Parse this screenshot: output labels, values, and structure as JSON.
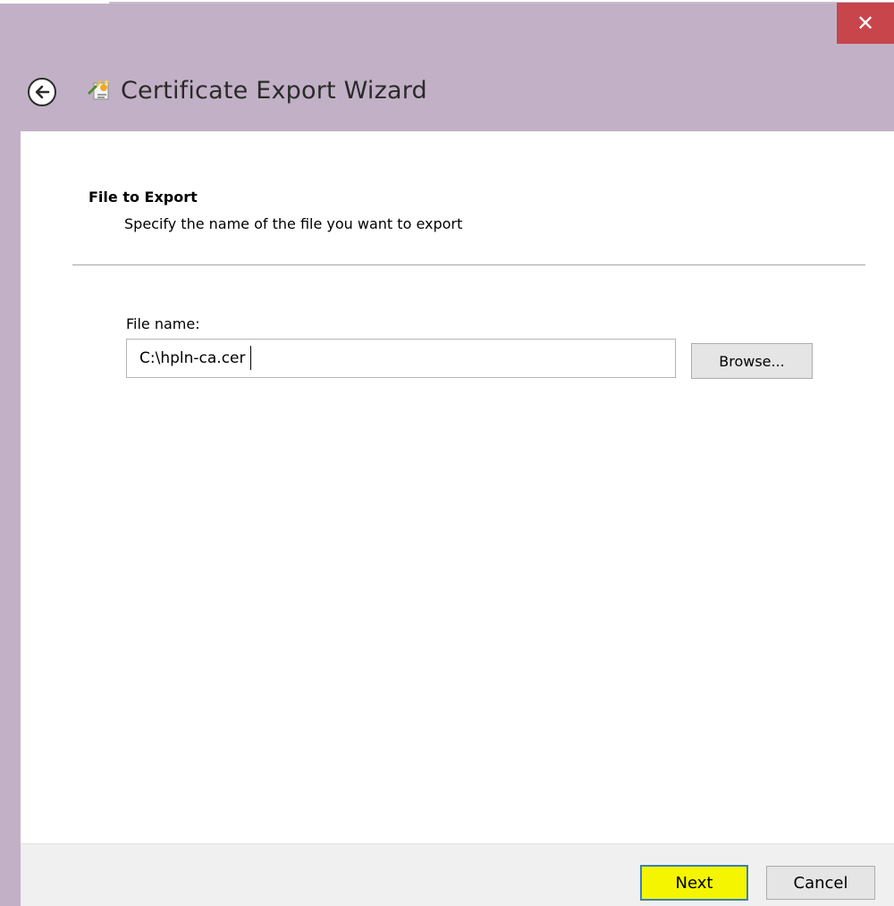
{
  "window": {
    "title": "Certificate Export Wizard",
    "close_icon": "close-icon",
    "back_icon": "back-arrow-icon",
    "app_icon": "certificate-wizard-icon",
    "colors": {
      "frame": "#c2b1c6",
      "close_button": "#c7454b",
      "content": "#ffffff",
      "footer": "#f0f0f0",
      "next_highlight": "#f5f500"
    }
  },
  "page": {
    "heading": "File to Export",
    "description": "Specify the name of the file you want to export",
    "file_name_label": "File name:",
    "file_name_value": "C:\\hpln-ca.cer",
    "browse_label": "Browse..."
  },
  "footer": {
    "next_label": "Next",
    "cancel_label": "Cancel"
  }
}
